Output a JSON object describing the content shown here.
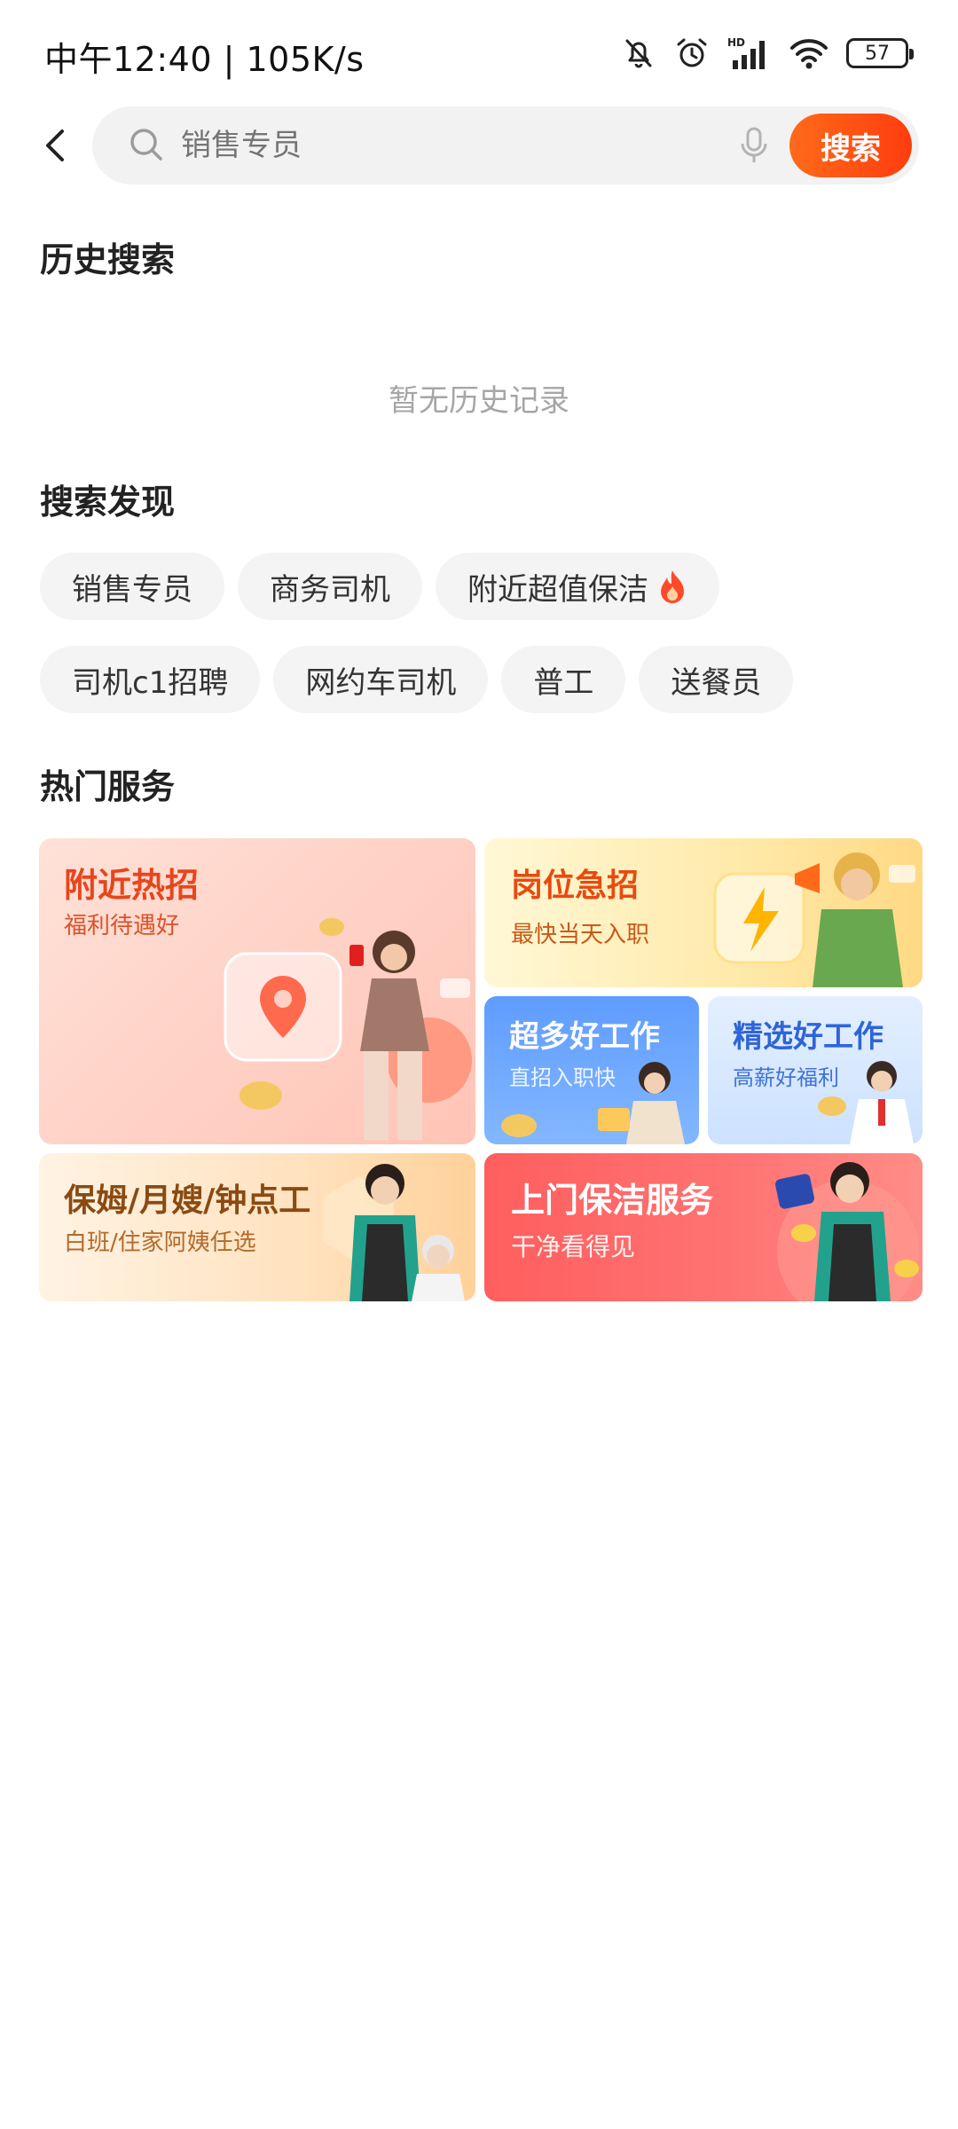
{
  "status_bar": {
    "time_speed": "中午12:40 | 105K/s",
    "battery": "57",
    "icons": [
      "bell-off-icon",
      "alarm-icon",
      "hd-signal-icon",
      "wifi-icon",
      "battery-icon"
    ]
  },
  "search": {
    "placeholder": "销售专员",
    "button_label": "搜索"
  },
  "history": {
    "title": "历史搜索",
    "empty_text": "暂无历史记录"
  },
  "discover": {
    "title": "搜索发现",
    "chips": [
      "销售专员",
      "商务司机",
      "附近超值保洁",
      "司机c1招聘",
      "网约车司机",
      "普工",
      "送餐员"
    ]
  },
  "services": {
    "title": "热门服务",
    "cards": [
      {
        "title": "附近热招",
        "subtitle": "福利待遇好"
      },
      {
        "title": "岗位急招",
        "subtitle": "最快当天入职"
      },
      {
        "title": "超多好工作",
        "subtitle": "直招入职快"
      },
      {
        "title": "精选好工作",
        "subtitle": "高薪好福利"
      },
      {
        "title": "保姆/月嫂/钟点工",
        "subtitle": "白班/住家阿姨任选"
      },
      {
        "title": "上门保洁服务",
        "subtitle": "干净看得见"
      }
    ]
  },
  "colors": {
    "accent": "#ff4d12",
    "chip_bg": "#f4f4f4",
    "search_bg": "#f2f2f2"
  }
}
